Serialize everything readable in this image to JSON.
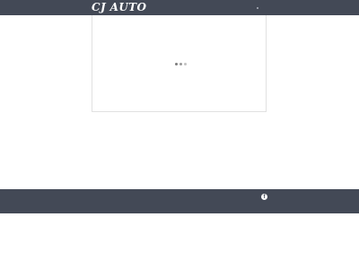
{
  "header": {
    "logo_text": "CJ AUTO"
  },
  "footer": {
    "facebook_icon": "f"
  }
}
